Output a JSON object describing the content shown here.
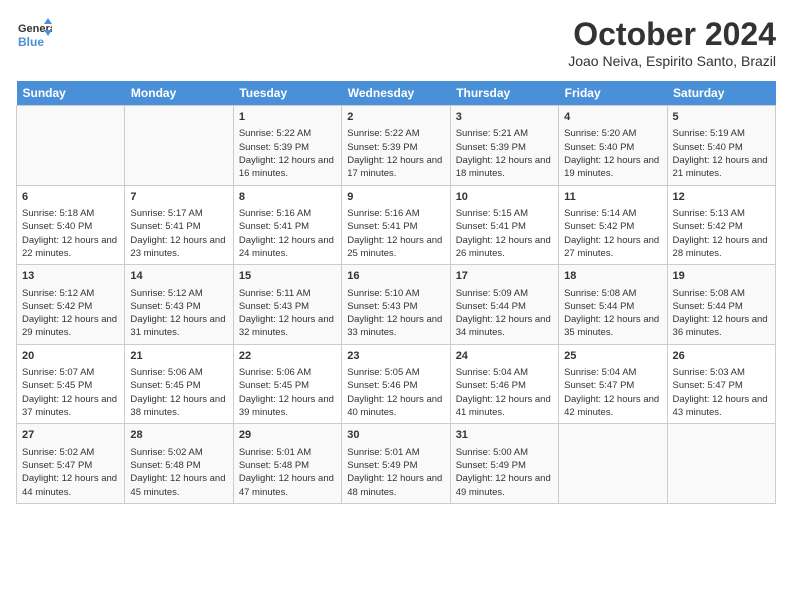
{
  "header": {
    "logo_line1": "General",
    "logo_line2": "Blue",
    "month_title": "October 2024",
    "location": "Joao Neiva, Espirito Santo, Brazil"
  },
  "weekdays": [
    "Sunday",
    "Monday",
    "Tuesday",
    "Wednesday",
    "Thursday",
    "Friday",
    "Saturday"
  ],
  "weeks": [
    [
      {
        "day": "",
        "sunrise": "",
        "sunset": "",
        "daylight": ""
      },
      {
        "day": "",
        "sunrise": "",
        "sunset": "",
        "daylight": ""
      },
      {
        "day": "1",
        "sunrise": "Sunrise: 5:22 AM",
        "sunset": "Sunset: 5:39 PM",
        "daylight": "Daylight: 12 hours and 16 minutes."
      },
      {
        "day": "2",
        "sunrise": "Sunrise: 5:22 AM",
        "sunset": "Sunset: 5:39 PM",
        "daylight": "Daylight: 12 hours and 17 minutes."
      },
      {
        "day": "3",
        "sunrise": "Sunrise: 5:21 AM",
        "sunset": "Sunset: 5:39 PM",
        "daylight": "Daylight: 12 hours and 18 minutes."
      },
      {
        "day": "4",
        "sunrise": "Sunrise: 5:20 AM",
        "sunset": "Sunset: 5:40 PM",
        "daylight": "Daylight: 12 hours and 19 minutes."
      },
      {
        "day": "5",
        "sunrise": "Sunrise: 5:19 AM",
        "sunset": "Sunset: 5:40 PM",
        "daylight": "Daylight: 12 hours and 21 minutes."
      }
    ],
    [
      {
        "day": "6",
        "sunrise": "Sunrise: 5:18 AM",
        "sunset": "Sunset: 5:40 PM",
        "daylight": "Daylight: 12 hours and 22 minutes."
      },
      {
        "day": "7",
        "sunrise": "Sunrise: 5:17 AM",
        "sunset": "Sunset: 5:41 PM",
        "daylight": "Daylight: 12 hours and 23 minutes."
      },
      {
        "day": "8",
        "sunrise": "Sunrise: 5:16 AM",
        "sunset": "Sunset: 5:41 PM",
        "daylight": "Daylight: 12 hours and 24 minutes."
      },
      {
        "day": "9",
        "sunrise": "Sunrise: 5:16 AM",
        "sunset": "Sunset: 5:41 PM",
        "daylight": "Daylight: 12 hours and 25 minutes."
      },
      {
        "day": "10",
        "sunrise": "Sunrise: 5:15 AM",
        "sunset": "Sunset: 5:41 PM",
        "daylight": "Daylight: 12 hours and 26 minutes."
      },
      {
        "day": "11",
        "sunrise": "Sunrise: 5:14 AM",
        "sunset": "Sunset: 5:42 PM",
        "daylight": "Daylight: 12 hours and 27 minutes."
      },
      {
        "day": "12",
        "sunrise": "Sunrise: 5:13 AM",
        "sunset": "Sunset: 5:42 PM",
        "daylight": "Daylight: 12 hours and 28 minutes."
      }
    ],
    [
      {
        "day": "13",
        "sunrise": "Sunrise: 5:12 AM",
        "sunset": "Sunset: 5:42 PM",
        "daylight": "Daylight: 12 hours and 29 minutes."
      },
      {
        "day": "14",
        "sunrise": "Sunrise: 5:12 AM",
        "sunset": "Sunset: 5:43 PM",
        "daylight": "Daylight: 12 hours and 31 minutes."
      },
      {
        "day": "15",
        "sunrise": "Sunrise: 5:11 AM",
        "sunset": "Sunset: 5:43 PM",
        "daylight": "Daylight: 12 hours and 32 minutes."
      },
      {
        "day": "16",
        "sunrise": "Sunrise: 5:10 AM",
        "sunset": "Sunset: 5:43 PM",
        "daylight": "Daylight: 12 hours and 33 minutes."
      },
      {
        "day": "17",
        "sunrise": "Sunrise: 5:09 AM",
        "sunset": "Sunset: 5:44 PM",
        "daylight": "Daylight: 12 hours and 34 minutes."
      },
      {
        "day": "18",
        "sunrise": "Sunrise: 5:08 AM",
        "sunset": "Sunset: 5:44 PM",
        "daylight": "Daylight: 12 hours and 35 minutes."
      },
      {
        "day": "19",
        "sunrise": "Sunrise: 5:08 AM",
        "sunset": "Sunset: 5:44 PM",
        "daylight": "Daylight: 12 hours and 36 minutes."
      }
    ],
    [
      {
        "day": "20",
        "sunrise": "Sunrise: 5:07 AM",
        "sunset": "Sunset: 5:45 PM",
        "daylight": "Daylight: 12 hours and 37 minutes."
      },
      {
        "day": "21",
        "sunrise": "Sunrise: 5:06 AM",
        "sunset": "Sunset: 5:45 PM",
        "daylight": "Daylight: 12 hours and 38 minutes."
      },
      {
        "day": "22",
        "sunrise": "Sunrise: 5:06 AM",
        "sunset": "Sunset: 5:45 PM",
        "daylight": "Daylight: 12 hours and 39 minutes."
      },
      {
        "day": "23",
        "sunrise": "Sunrise: 5:05 AM",
        "sunset": "Sunset: 5:46 PM",
        "daylight": "Daylight: 12 hours and 40 minutes."
      },
      {
        "day": "24",
        "sunrise": "Sunrise: 5:04 AM",
        "sunset": "Sunset: 5:46 PM",
        "daylight": "Daylight: 12 hours and 41 minutes."
      },
      {
        "day": "25",
        "sunrise": "Sunrise: 5:04 AM",
        "sunset": "Sunset: 5:47 PM",
        "daylight": "Daylight: 12 hours and 42 minutes."
      },
      {
        "day": "26",
        "sunrise": "Sunrise: 5:03 AM",
        "sunset": "Sunset: 5:47 PM",
        "daylight": "Daylight: 12 hours and 43 minutes."
      }
    ],
    [
      {
        "day": "27",
        "sunrise": "Sunrise: 5:02 AM",
        "sunset": "Sunset: 5:47 PM",
        "daylight": "Daylight: 12 hours and 44 minutes."
      },
      {
        "day": "28",
        "sunrise": "Sunrise: 5:02 AM",
        "sunset": "Sunset: 5:48 PM",
        "daylight": "Daylight: 12 hours and 45 minutes."
      },
      {
        "day": "29",
        "sunrise": "Sunrise: 5:01 AM",
        "sunset": "Sunset: 5:48 PM",
        "daylight": "Daylight: 12 hours and 47 minutes."
      },
      {
        "day": "30",
        "sunrise": "Sunrise: 5:01 AM",
        "sunset": "Sunset: 5:49 PM",
        "daylight": "Daylight: 12 hours and 48 minutes."
      },
      {
        "day": "31",
        "sunrise": "Sunrise: 5:00 AM",
        "sunset": "Sunset: 5:49 PM",
        "daylight": "Daylight: 12 hours and 49 minutes."
      },
      {
        "day": "",
        "sunrise": "",
        "sunset": "",
        "daylight": ""
      },
      {
        "day": "",
        "sunrise": "",
        "sunset": "",
        "daylight": ""
      }
    ]
  ]
}
